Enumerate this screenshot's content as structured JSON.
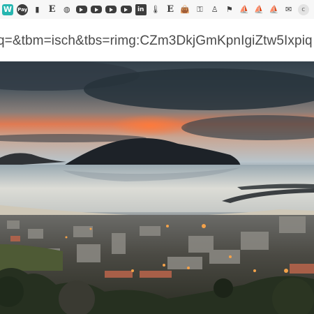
{
  "bookmarks": [
    {
      "name": "bookmark-w-icon",
      "glyph": "W",
      "style": "first"
    },
    {
      "name": "bookmark-pay-icon",
      "glyph": "Pay",
      "style": "circ"
    },
    {
      "name": "bookmark-notebook-icon",
      "glyph": "▮",
      "style": "plain"
    },
    {
      "name": "bookmark-e-icon",
      "glyph": "E",
      "style": "serif"
    },
    {
      "name": "bookmark-globe-icon",
      "glyph": "◍",
      "style": "plain"
    },
    {
      "name": "bookmark-youtube-icon-1",
      "glyph": "",
      "style": "yt"
    },
    {
      "name": "bookmark-youtube-icon-2",
      "glyph": "",
      "style": "yt"
    },
    {
      "name": "bookmark-youtube-icon-3",
      "glyph": "",
      "style": "yt"
    },
    {
      "name": "bookmark-youtube-icon-4",
      "glyph": "",
      "style": "yt"
    },
    {
      "name": "bookmark-linkedin-icon",
      "glyph": "in",
      "style": "sq"
    },
    {
      "name": "bookmark-thermometer-icon",
      "glyph": "🌡",
      "style": "plain"
    },
    {
      "name": "bookmark-e-underline-icon",
      "glyph": "E",
      "style": "serif"
    },
    {
      "name": "bookmark-bag-icon",
      "glyph": "👜",
      "style": "plain"
    },
    {
      "name": "bookmark-key-icon",
      "glyph": "⚿",
      "style": "plain"
    },
    {
      "name": "bookmark-person-icon",
      "glyph": "♙",
      "style": "plain"
    },
    {
      "name": "bookmark-flag-icon",
      "glyph": "⚑",
      "style": "plain"
    },
    {
      "name": "bookmark-ship-icon-1",
      "glyph": "⛵",
      "style": "plain"
    },
    {
      "name": "bookmark-ship-icon-2",
      "glyph": "⛵",
      "style": "plain"
    },
    {
      "name": "bookmark-ship-icon-3",
      "glyph": "⛵",
      "style": "plain"
    },
    {
      "name": "bookmark-mail-icon",
      "glyph": "✉",
      "style": "plain"
    },
    {
      "name": "bookmark-c-icon",
      "glyph": "c",
      "style": "cgray"
    },
    {
      "name": "bookmark-ship-icon-4",
      "glyph": "⛵",
      "style": "plain"
    }
  ],
  "address_bar": {
    "url_text": "q=&tbm=isch&tbs=rimg:CZm3DkjGmKpnIgiZtw5Ixpiq"
  },
  "image": {
    "subject": "coastal-town-sunset-photo"
  }
}
